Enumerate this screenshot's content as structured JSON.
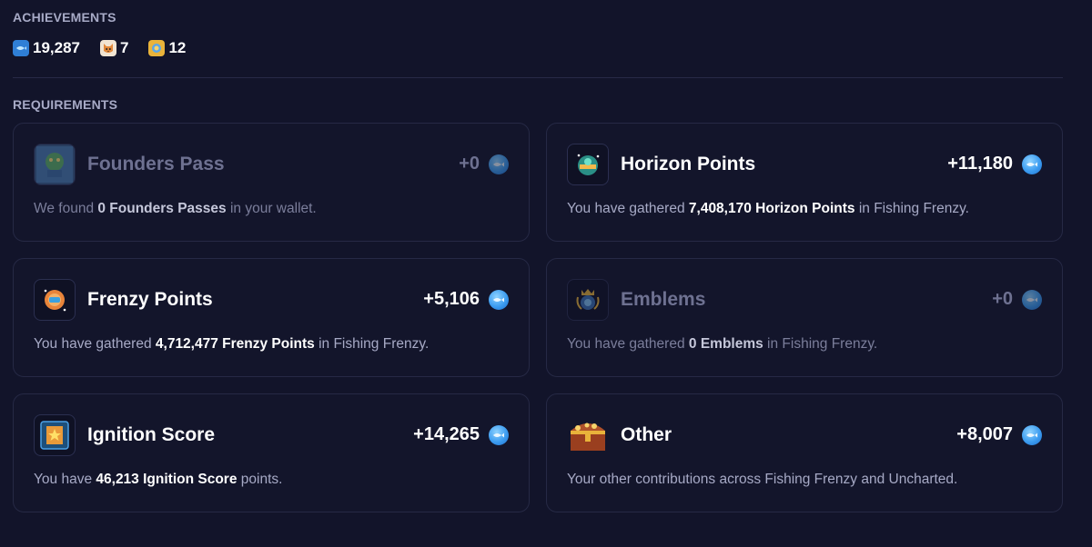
{
  "achievements": {
    "title": "ACHIEVEMENTS",
    "items": [
      {
        "icon": "fish-badge-icon",
        "value": "19,287"
      },
      {
        "icon": "shiba-badge-icon",
        "value": "7"
      },
      {
        "icon": "gold-badge-icon",
        "value": "12"
      }
    ]
  },
  "requirements": {
    "title": "REQUIREMENTS",
    "cards": [
      {
        "icon": "founders-pass-icon",
        "name": "Founders Pass",
        "points": "+0",
        "desc_pre": "We found ",
        "desc_bold": "0 Founders Passes",
        "desc_post": " in your wallet."
      },
      {
        "icon": "horizon-points-icon",
        "name": "Horizon Points",
        "points": "+11,180",
        "desc_pre": "You have gathered ",
        "desc_bold": "7,408,170 Horizon Points",
        "desc_post": " in Fishing Frenzy."
      },
      {
        "icon": "frenzy-points-icon",
        "name": "Frenzy Points",
        "points": "+5,106",
        "desc_pre": "You have gathered ",
        "desc_bold": "4,712,477 Frenzy Points",
        "desc_post": " in Fishing Frenzy."
      },
      {
        "icon": "emblems-icon",
        "name": "Emblems",
        "points": "+0",
        "desc_pre": "You have gathered ",
        "desc_bold": "0 Emblems",
        "desc_post": " in Fishing Frenzy."
      },
      {
        "icon": "ignition-score-icon",
        "name": "Ignition Score",
        "points": "+14,265",
        "desc_pre": "You have ",
        "desc_bold": "46,213 Ignition Score",
        "desc_post": " points."
      },
      {
        "icon": "treasure-chest-icon",
        "name": "Other",
        "points": "+8,007",
        "desc_pre": "Your other contributions across Fishing Frenzy and Uncharted.",
        "desc_bold": "",
        "desc_post": ""
      }
    ]
  },
  "colors": {
    "background": "#12142a",
    "card_border": "#262945",
    "accent_blue": "#3c9cf0",
    "muted_text": "#a7aac6"
  }
}
